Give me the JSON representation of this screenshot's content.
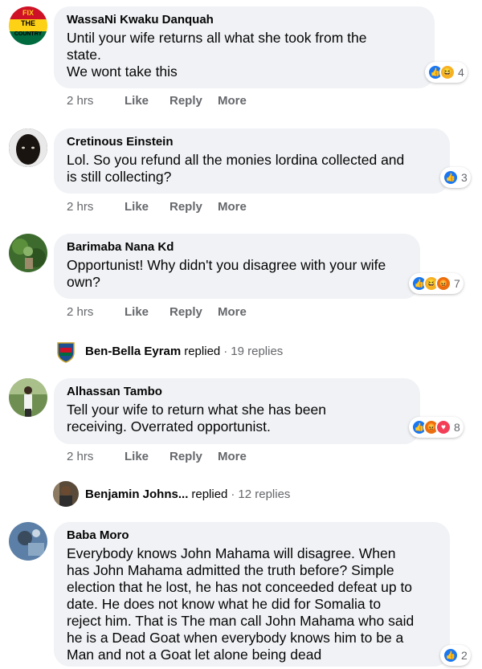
{
  "comments": [
    {
      "author": "WassaNi Kwaku Danquah",
      "text": "Until your wife returns all what she took from the\nstate.\nWe wont take this",
      "time": "2 hrs",
      "like": "Like",
      "reply": "Reply",
      "more": "More",
      "reaction_count": "4",
      "avatar_text": [
        "FIX",
        "THE",
        "COUNTRY"
      ]
    },
    {
      "author": "Cretinous Einstein",
      "text": "Lol. So you refund all the monies lordina collected and\nis still collecting?",
      "time": "2 hrs",
      "like": "Like",
      "reply": "Reply",
      "more": "More",
      "reaction_count": "3"
    },
    {
      "author": "Barimaba Nana Kd",
      "text": "Opportunist! Why didn't you disagree with your wife\nown?",
      "time": "2 hrs",
      "like": "Like",
      "reply": "Reply",
      "more": "More",
      "reaction_count": "7"
    },
    {
      "author": "Alhassan Tambo",
      "text": "Tell your wife to return what she has been\nreceiving. Overrated opportunist.",
      "time": "2 hrs",
      "like": "Like",
      "reply": "Reply",
      "more": "More",
      "reaction_count": "8"
    },
    {
      "author": "Baba Moro",
      "text": "Everybody knows John Mahama will disagree. When\nhas John Mahama admitted the truth before? Simple\nelection that he lost, he has not conceeded defeat up to\ndate. He does not know what he did for Somalia to\nreject him. That is The man call John Mahama who said\nhe is a Dead Goat when everybody knows him to be a\nMan and not a Goat let alone being dead",
      "reaction_count": "2"
    }
  ],
  "replies": [
    {
      "name": "Ben-Bella Eyram",
      "verb": "replied",
      "sep": "·",
      "count": "19 replies"
    },
    {
      "name": "Benjamin Johns...",
      "verb": "replied",
      "sep": "·",
      "count": "12 replies"
    }
  ],
  "colors": {
    "like": "#1877f2",
    "haha": "#f7b125",
    "angry": "#e9710f",
    "love": "#f33e58",
    "bubble": "#f0f2f5",
    "meta": "#65676b"
  }
}
